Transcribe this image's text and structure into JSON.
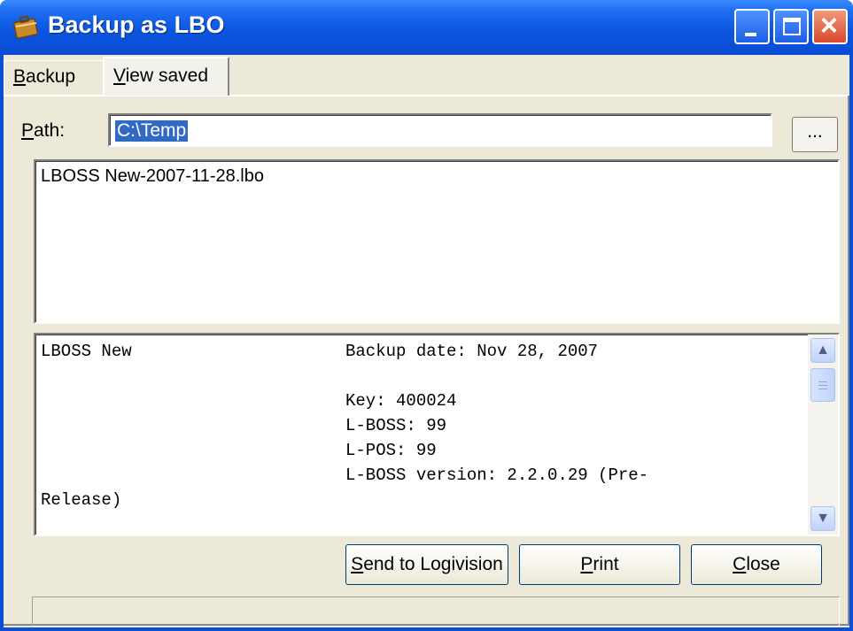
{
  "window": {
    "title": "Backup as LBO",
    "icon": "briefcase-icon",
    "controls": [
      "minimize-icon",
      "maximize-icon",
      "close-icon"
    ]
  },
  "tabs": [
    {
      "label": "Backup",
      "accel": "B",
      "rest": "ackup",
      "active": false
    },
    {
      "label": "View saved",
      "accel": "V",
      "rest": "iew saved",
      "active": true
    }
  ],
  "path": {
    "label_accel": "P",
    "label_rest": "ath:",
    "value": "C:\\Temp",
    "browse_label": "..."
  },
  "file_list": {
    "items": [
      "LBOSS New-2007-11-28.lbo"
    ]
  },
  "details": {
    "name": "LBOSS New",
    "backup_date": "Backup date: Nov 28, 2007",
    "key": "Key: 400024",
    "lboss": "L-BOSS: 99",
    "lpos": "L-POS: 99",
    "version": "L-BOSS version: 2.2.0.29 (Pre-",
    "version_wrap": "Release)"
  },
  "buttons": {
    "send": {
      "accel": "S",
      "rest": "end to Logivision"
    },
    "print": {
      "accel": "P",
      "rest": "rint"
    },
    "close": {
      "accel": "C",
      "rest": "lose"
    }
  },
  "colors": {
    "titlebar": "#0a4fd8",
    "client": "#ece9d8",
    "selection": "#316ac5"
  }
}
